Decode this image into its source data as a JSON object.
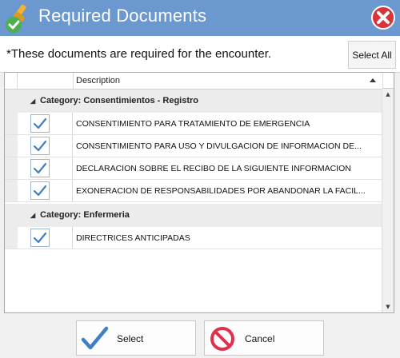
{
  "window": {
    "title": "Required Documents"
  },
  "header": {
    "note": "*These documents are required for the encounter.",
    "select_all_label": "Select All"
  },
  "grid": {
    "column_header": "Description",
    "groups": [
      {
        "label": "Category: Consentimientos - Registro",
        "rows": [
          {
            "checked": true,
            "description": "CONSENTIMIENTO PARA TRATAMIENTO DE EMERGENCIA"
          },
          {
            "checked": true,
            "description": "CONSENTIMIENTO PARA USO Y DIVULGACION DE INFORMACION DE..."
          },
          {
            "checked": true,
            "description": "DECLARACION SOBRE EL RECIBO DE LA SIGUIENTE INFORMACION"
          },
          {
            "checked": true,
            "description": "EXONERACION DE RESPONSABILIDADES POR ABANDONAR LA FACIL..."
          }
        ]
      },
      {
        "label": "Category: Enfermeria",
        "rows": [
          {
            "checked": true,
            "description": "DIRECTRICES ANTICIPADAS"
          }
        ]
      }
    ]
  },
  "footer": {
    "select_label": "Select",
    "cancel_label": "Cancel"
  },
  "icons": {
    "app": "pill-wrench-check-icon",
    "close": "close-icon",
    "checkbox": "checkmark-icon",
    "select": "checkmark-icon",
    "cancel": "no-entry-icon"
  },
  "colors": {
    "titlebar": "#6a98cf",
    "check": "#3f7fc4",
    "cancel": "#e0304a",
    "close": "#d8353a"
  }
}
